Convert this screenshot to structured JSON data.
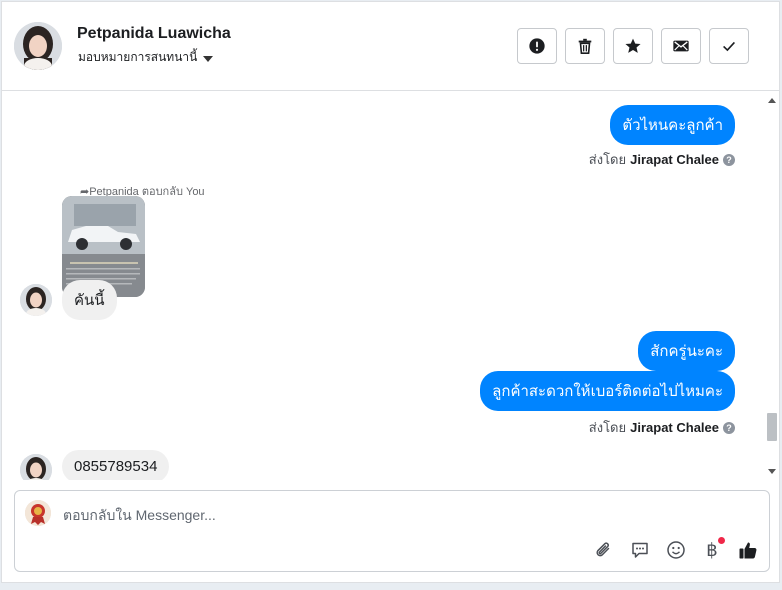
{
  "header": {
    "contact_name": "Petpanida Luawicha",
    "assign_label": "มอบหมายการสนทนานี้",
    "actions": [
      {
        "id": "spam",
        "icon": "alert-circle-icon"
      },
      {
        "id": "delete",
        "icon": "trash-icon"
      },
      {
        "id": "star",
        "icon": "star-icon"
      },
      {
        "id": "unread",
        "icon": "envelope-icon"
      },
      {
        "id": "done",
        "icon": "check-icon"
      }
    ]
  },
  "thread": {
    "msg1": "ตัวไหนคะลูกค้า",
    "sent_by_prefix": "ส่งโดย",
    "sent_by_name_1": "Jirapat Chalee",
    "replied_label": "Petpanida ตอบกลับ You",
    "msg2": "คันนี้",
    "msg3": "สักครู่นะคะ",
    "msg4": "ลูกค้าสะดวกให้เบอร์ติดต่อไปไหมคะ",
    "sent_by_name_2": "Jirapat Chalee",
    "msg5": "0855789534",
    "help_glyph": "?"
  },
  "composer": {
    "placeholder": "ตอบกลับใน Messenger...",
    "tools": [
      "paperclip-icon",
      "chat-bubble-icon",
      "emoji-icon",
      "baht-icon",
      "thumbs-up-icon"
    ],
    "baht_glyph": "฿"
  },
  "colors": {
    "outgoing_bubble": "#0084ff",
    "incoming_bubble": "#f0f0f0",
    "notification_dot": "#f02849"
  }
}
